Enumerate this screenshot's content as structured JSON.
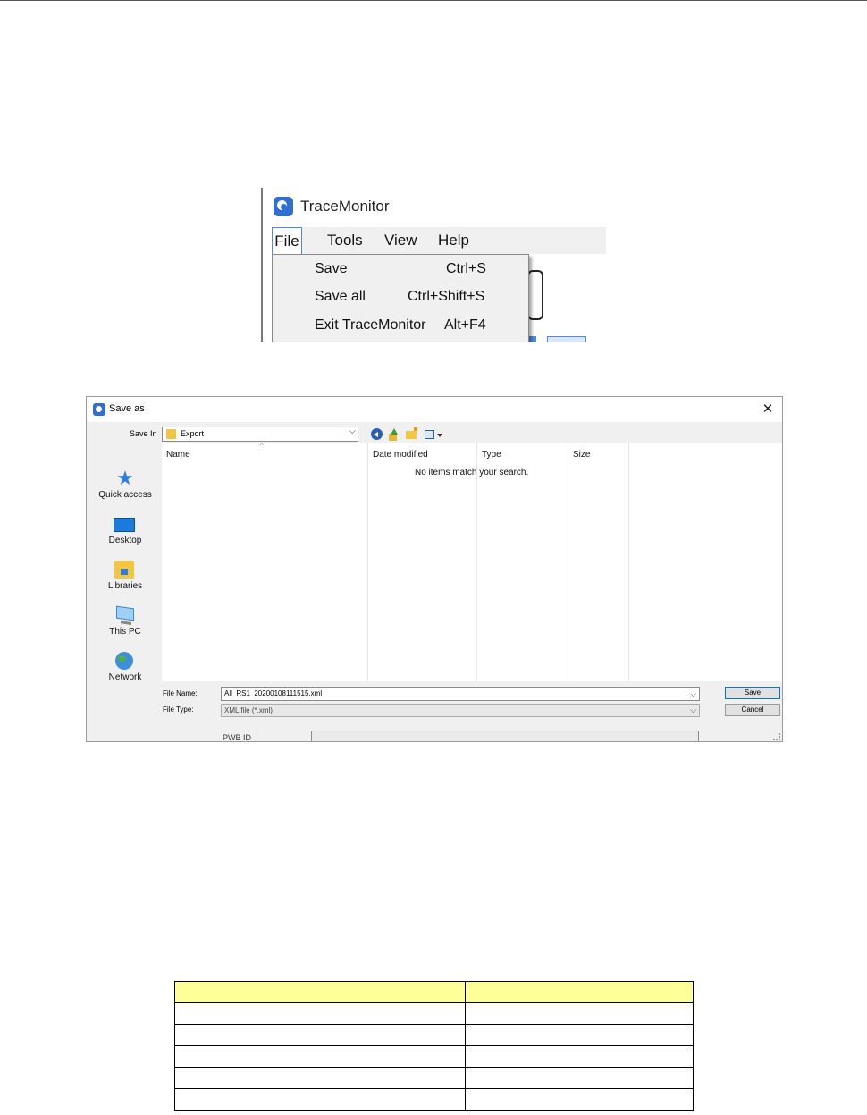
{
  "tracemonitor": {
    "title": "TraceMonitor",
    "menubar": [
      {
        "label": "File"
      },
      {
        "label": "Tools"
      },
      {
        "label": "View"
      },
      {
        "label": "Help"
      }
    ],
    "file_menu": [
      {
        "label": "Save",
        "shortcut": "Ctrl+S"
      },
      {
        "label": "Save all",
        "shortcut": "Ctrl+Shift+S"
      },
      {
        "label": "Exit TraceMonitor",
        "shortcut": "Alt+F4"
      }
    ]
  },
  "save_dialog": {
    "title": "Save as",
    "close_glyph": "✕",
    "save_in_label": "Save In",
    "save_in_value": "Export",
    "places": [
      {
        "label": "Quick access",
        "icon": "quick-access-icon"
      },
      {
        "label": "Desktop",
        "icon": "desktop-icon"
      },
      {
        "label": "Libraries",
        "icon": "libraries-icon"
      },
      {
        "label": "This PC",
        "icon": "this-pc-icon"
      },
      {
        "label": "Network",
        "icon": "network-icon"
      }
    ],
    "columns": [
      "Name",
      "Date modified",
      "Type",
      "Size"
    ],
    "empty_message": "No items match your search.",
    "file_name_label": "File Name:",
    "file_name_value": "All_RS1_20200108111515.xml",
    "file_type_label": "File Type:",
    "file_type_value": "XML file (*.xml)",
    "save_button": "Save",
    "cancel_button": "Cancel",
    "pwb_label": "PWB ID"
  },
  "table": {
    "header_color": "#ffff99",
    "rows": 6,
    "columns": 2
  }
}
